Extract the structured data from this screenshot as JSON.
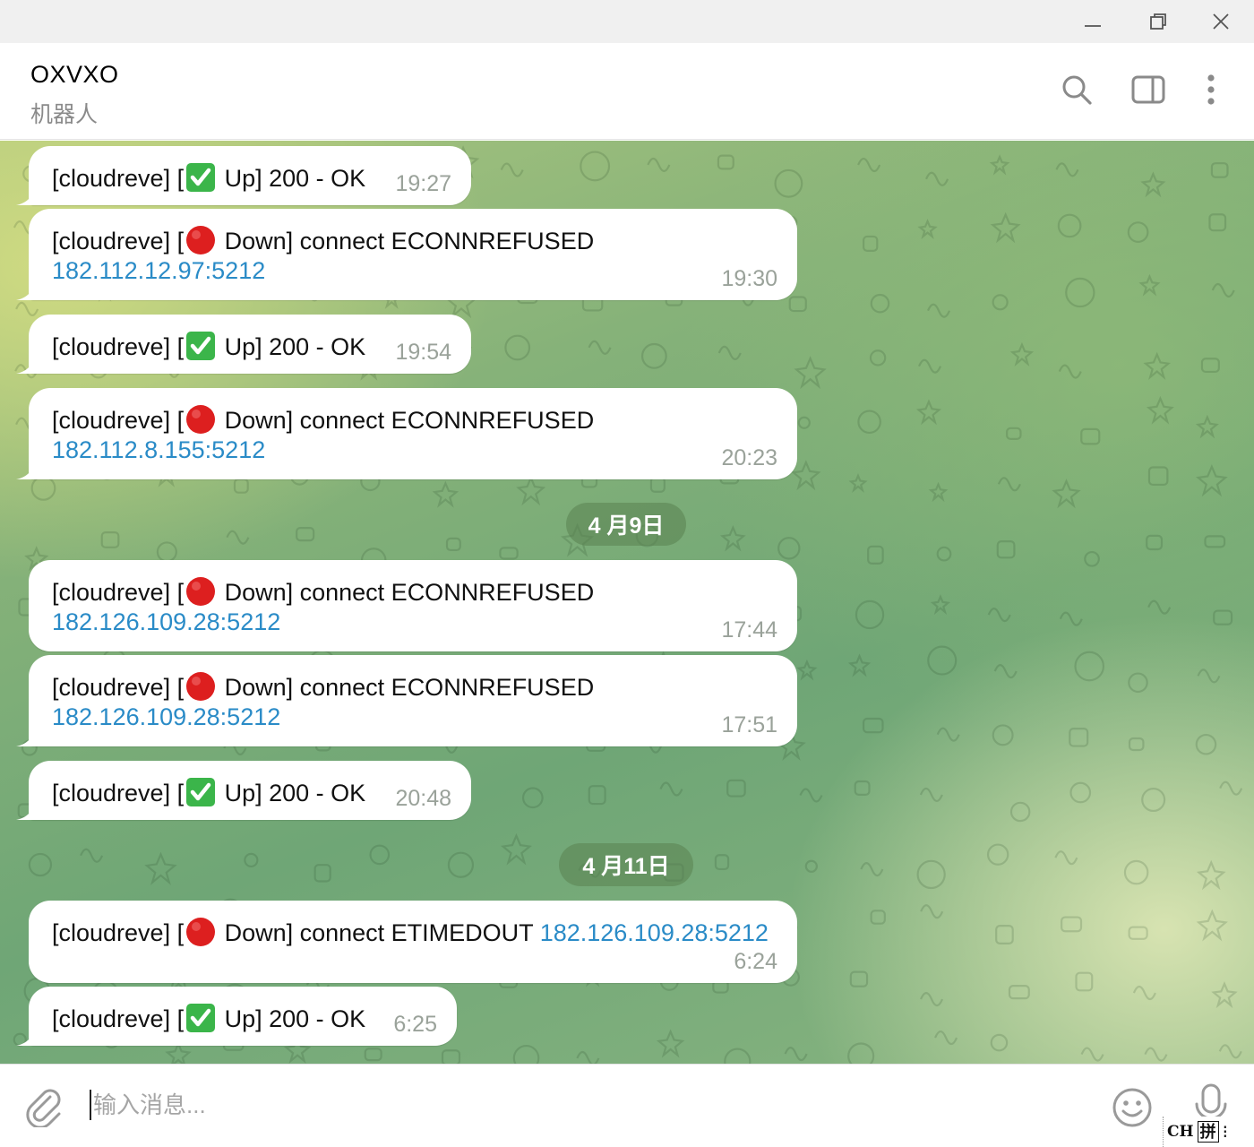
{
  "window": {
    "minimize_icon": "minimize-icon",
    "maximize_icon": "restore-icon",
    "close_icon": "close-icon"
  },
  "header": {
    "title": "OXVXO",
    "subtitle": "机器人",
    "icons": [
      "search-icon",
      "side-panel-icon",
      "more-vertical-icon"
    ]
  },
  "colors": {
    "link": "#2a8bc7",
    "time": "#9aa29a",
    "bubble": "#ffffff",
    "date_pill": "#5a8250"
  },
  "messages": [
    {
      "prefix": "[cloudreve] [",
      "status_icon": "check-mark-icon",
      "suffix": " Up] 200 - OK",
      "time": "19:27"
    },
    {
      "prefix": "[cloudreve] [",
      "status_icon": "red-circle-icon",
      "suffix": " Down] connect ECONNREFUSED",
      "ip": "182.112.12.97:5212",
      "time": "19:30"
    },
    {
      "prefix": "[cloudreve] [",
      "status_icon": "check-mark-icon",
      "suffix": " Up] 200 - OK",
      "time": "19:54"
    },
    {
      "prefix": "[cloudreve] [",
      "status_icon": "red-circle-icon",
      "suffix": " Down] connect ECONNREFUSED",
      "ip": "182.112.8.155:5212",
      "time": "20:23"
    },
    {
      "prefix": "[cloudreve] [",
      "status_icon": "red-circle-icon",
      "suffix": " Down] connect ECONNREFUSED",
      "ip": "182.126.109.28:5212",
      "time": "17:44"
    },
    {
      "prefix": "[cloudreve] [",
      "status_icon": "red-circle-icon",
      "suffix": " Down] connect ECONNREFUSED",
      "ip": "182.126.109.28:5212",
      "time": "17:51"
    },
    {
      "prefix": "[cloudreve] [",
      "status_icon": "check-mark-icon",
      "suffix": " Up] 200 - OK",
      "time": "20:48"
    },
    {
      "prefix": "[cloudreve] [",
      "status_icon": "red-circle-icon",
      "suffix": " Down] connect ETIMEDOUT ",
      "ip": "182.126.109.28:5212",
      "time": "6:24"
    },
    {
      "prefix": "[cloudreve] [",
      "status_icon": "check-mark-icon",
      "suffix": " Up] 200 - OK",
      "time": "6:25"
    }
  ],
  "date_separators": [
    "4 月9日",
    "4 月11日"
  ],
  "composer": {
    "placeholder": "输入消息...",
    "attach_icon": "paperclip-icon",
    "emoji_icon": "smiley-icon",
    "mic_icon": "microphone-icon"
  },
  "ime": {
    "mode": "CH",
    "input": "拼",
    "extra": "⁝"
  }
}
